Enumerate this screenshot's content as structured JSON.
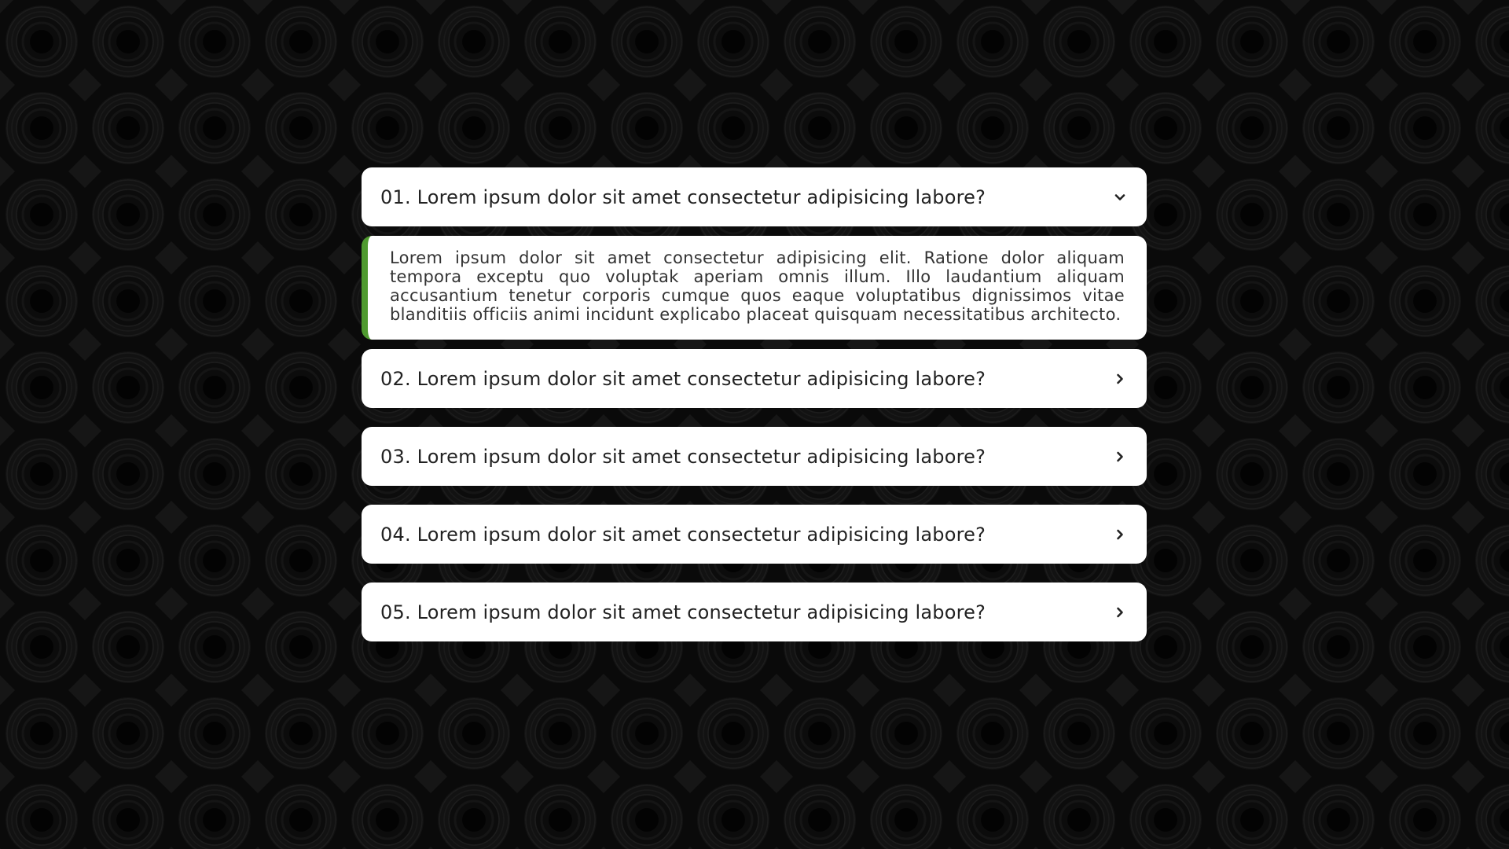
{
  "faq": {
    "items": [
      {
        "question": "01. Lorem ipsum dolor sit amet consectetur adipisicing labore?",
        "expanded": true,
        "icon": "chevron-down-icon",
        "answer": "Lorem ipsum dolor sit amet consectetur adipisicing elit. Ratione dolor aliquam tempora exceptu quo voluptak aperiam omnis illum. Illo laudantium aliquam accusantium tenetur corporis cumque quos eaque voluptatibus dignissimos vitae blanditiis officiis animi incidunt explicabo placeat quisquam necessitatibus architecto."
      },
      {
        "question": "02. Lorem ipsum dolor sit amet consectetur adipisicing labore?",
        "expanded": false,
        "icon": "chevron-right-icon"
      },
      {
        "question": "03. Lorem ipsum dolor sit amet consectetur adipisicing labore?",
        "expanded": false,
        "icon": "chevron-right-icon"
      },
      {
        "question": "04. Lorem ipsum dolor sit amet consectetur adipisicing labore?",
        "expanded": false,
        "icon": "chevron-right-icon"
      },
      {
        "question": "05. Lorem ipsum dolor sit amet consectetur adipisicing labore?",
        "expanded": false,
        "icon": "chevron-right-icon"
      }
    ]
  },
  "colors": {
    "background": "#0a0a0a",
    "card": "#ffffff",
    "accent": "#4f9a2f",
    "text": "#222222"
  }
}
